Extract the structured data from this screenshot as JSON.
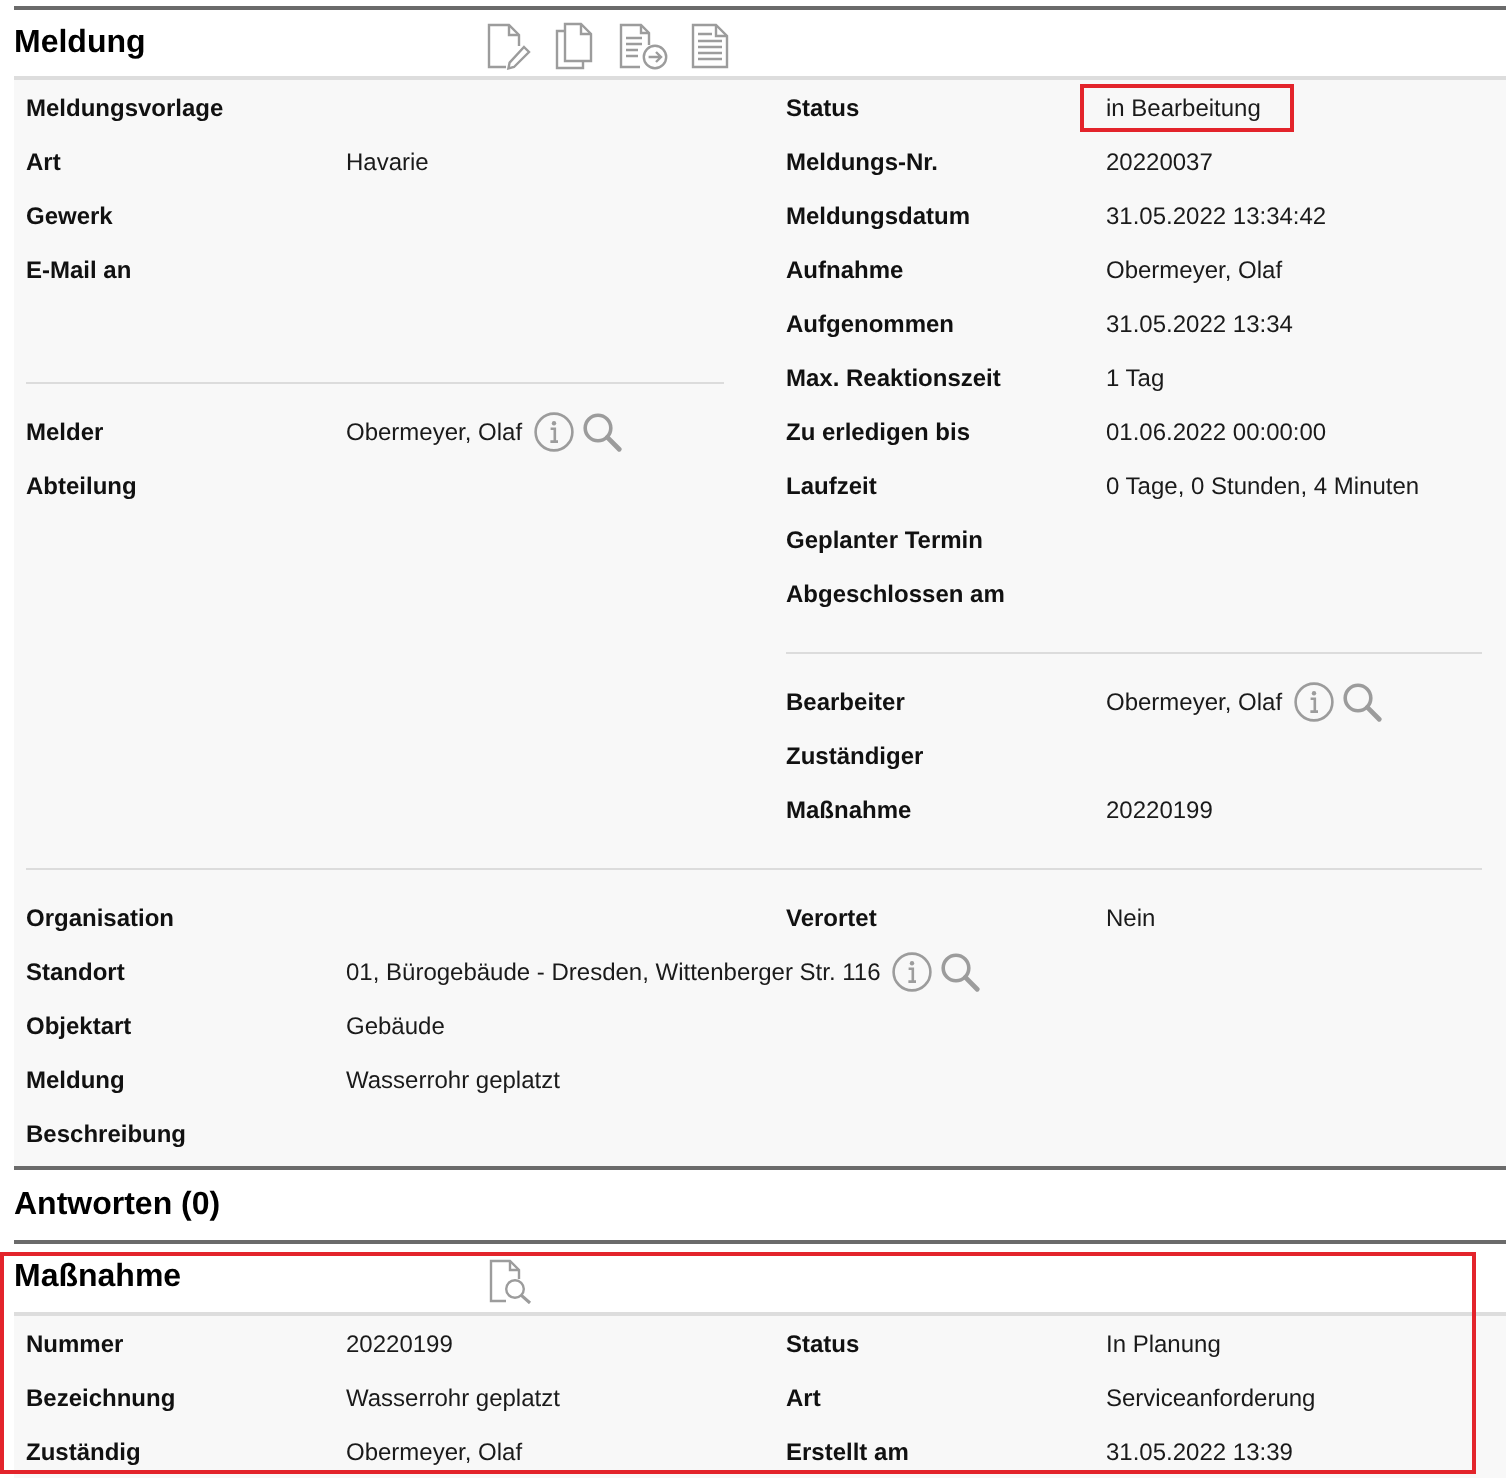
{
  "meldung": {
    "title": "Meldung",
    "upper_left": [
      [
        {
          "label": "Meldungsvorlage"
        },
        {
          "label": "Art",
          "value": "Havarie"
        },
        {
          "label": "Gewerk"
        },
        {
          "label": "E-Mail an"
        }
      ],
      [
        {
          "label": "Melder",
          "value": "Obermeyer, Olaf",
          "kind": "lookup"
        },
        {
          "label": "Abteilung",
          "kind": "plain"
        }
      ]
    ],
    "upper_right": [
      [
        {
          "label": "Status",
          "value": "in Bearbeitung",
          "highlighted": true
        },
        {
          "label": "Meldungs-Nr.",
          "value": "20220037"
        },
        {
          "label": "Meldungsdatum",
          "value": "31.05.2022 13:34:42"
        },
        {
          "label": "Aufnahme",
          "value": "Obermeyer, Olaf"
        },
        {
          "label": "Aufgenommen",
          "value": "31.05.2022 13:34"
        },
        {
          "label": "Max. Reaktionszeit",
          "value": "1 Tag"
        },
        {
          "label": "Zu erledigen bis",
          "value": "01.06.2022 00:00:00"
        },
        {
          "label": "Laufzeit",
          "value": "0 Tage, 0 Stunden, 4 Minuten"
        },
        {
          "label": "Geplanter Termin"
        },
        {
          "label": "Abgeschlossen am"
        }
      ],
      [
        {
          "label": "Bearbeiter",
          "value": "Obermeyer, Olaf",
          "kind": "lookup"
        },
        {
          "label": "Zuständiger",
          "kind": "plain"
        },
        {
          "label": "Maßnahme",
          "value": "20220199",
          "kind": "plain"
        }
      ]
    ],
    "lower_left": [
      {
        "label": "Organisation",
        "kind": "plain"
      },
      {
        "label": "Standort",
        "value": "01, Bürogebäude - Dresden, Wittenberger Str. 116",
        "kind": "lookup"
      },
      {
        "label": "Objektart",
        "value": "Gebäude",
        "kind": "plain"
      },
      {
        "label": "Meldung",
        "value": "Wasserrohr geplatzt",
        "kind": "plain"
      },
      {
        "label": "Beschreibung",
        "kind": "plain"
      }
    ],
    "lower_right": [
      {
        "label": "Verortet",
        "value": "Nein"
      }
    ]
  },
  "antworten": {
    "title": "Antworten (0)"
  },
  "massnahme": {
    "title": "Maßnahme",
    "highlighted": true,
    "left": [
      {
        "label": "Nummer",
        "value": "20220199"
      },
      {
        "label": "Bezeichnung",
        "value": "Wasserrohr geplatzt"
      },
      {
        "label": "Zuständig",
        "value": "Obermeyer, Olaf"
      }
    ],
    "right": [
      {
        "label": "Status",
        "value": "In Planung"
      },
      {
        "label": "Art",
        "value": "Serviceanforderung"
      },
      {
        "label": "Erstellt am",
        "value": "31.05.2022 13:39"
      }
    ]
  }
}
